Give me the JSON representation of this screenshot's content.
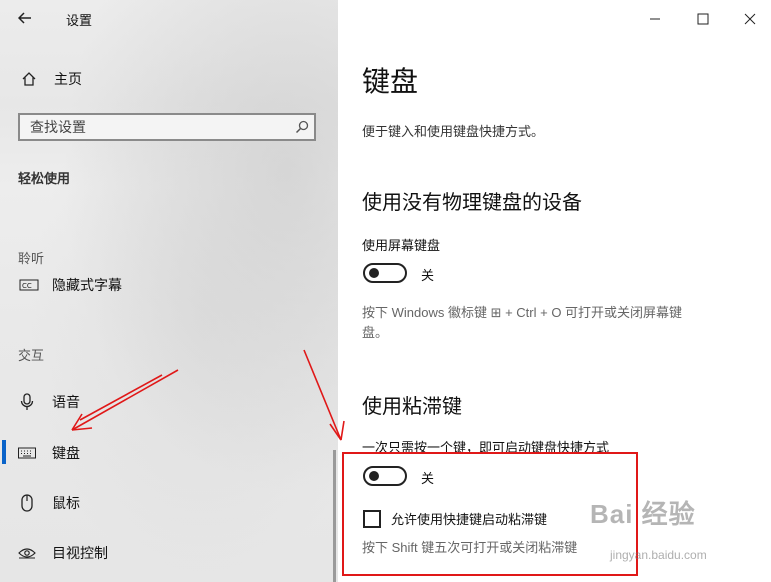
{
  "app": {
    "title": "设置"
  },
  "sidebar": {
    "home_label": "主页",
    "search_placeholder": "查找设置",
    "section_heading": "轻松使用",
    "group_hearing": "聆听",
    "item_captions": "隐藏式字幕",
    "group_interaction": "交互",
    "item_speech": "语音",
    "item_keyboard": "键盘",
    "item_mouse": "鼠标",
    "item_eye_control": "目视控制",
    "selected_item": "键盘",
    "accent_color": "#0a63c9"
  },
  "main": {
    "title": "键盘",
    "description": "便于键入和使用键盘快捷方式。",
    "section1": {
      "heading": "使用没有物理键盘的设备",
      "setting_label": "使用屏幕键盘",
      "toggle_state": "关",
      "toggle_on": false,
      "hint_line1": "按下 Windows 徽标键 ⊞ + Ctrl + O 可打开或关闭屏幕键",
      "hint_line2": "盘。"
    },
    "section2": {
      "heading": "使用粘滞键",
      "setting_label": "一次只需按一个键，即可启动键盘快捷方式",
      "toggle_state": "关",
      "toggle_on": false,
      "checkbox_label": "允许使用快捷键启动粘滞键",
      "checkbox_checked": false,
      "hint": "按下 Shift 键五次可打开或关闭粘滞键"
    }
  },
  "window_controls": {
    "minimize": "—",
    "maximize": "☐",
    "close": "✕"
  },
  "annotation": {
    "highlight_color": "#e01818",
    "arrow_color": "#e01818"
  },
  "watermark": {
    "text": "Bai 经验",
    "sub": "jingyan.baidu.com"
  }
}
